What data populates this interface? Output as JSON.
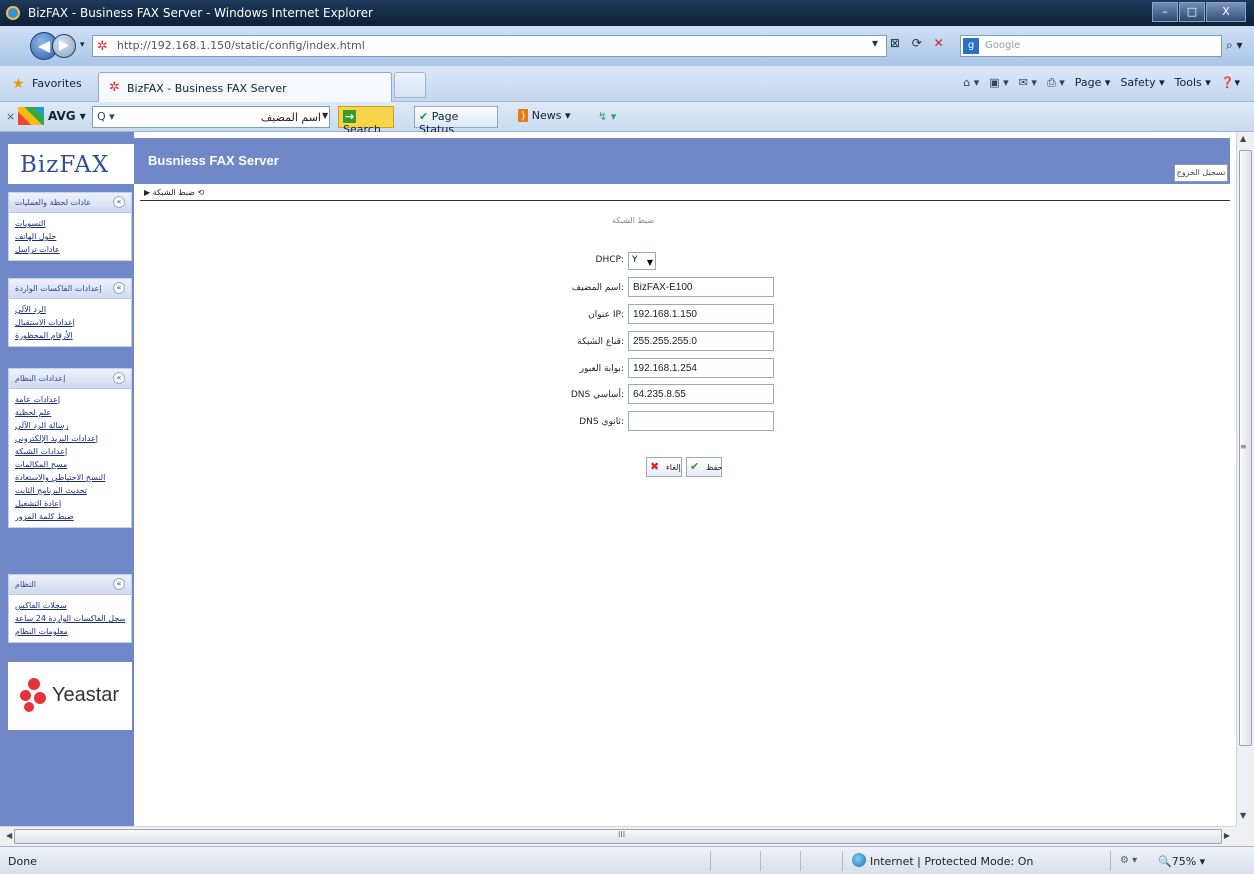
{
  "window": {
    "title": "BizFAX - Business FAX Server - Windows Internet Explorer",
    "minimize": "–",
    "maximize": "□",
    "close": "X"
  },
  "address_bar": {
    "back": "◀",
    "forward": "▶",
    "url": "http://192.168.1.150/static/config/index.html",
    "refresh_icon": "⟳",
    "stop_icon": "✕",
    "search_provider": "Google",
    "search_glyph": "g",
    "search_go": "⌕ ▾"
  },
  "tabs": {
    "favorites": "Favorites",
    "active_tab": "BizFAX - Business FAX Server",
    "commands": {
      "home": "⌂ ▾",
      "feeds": "▣ ▾",
      "mail": "✉ ▾",
      "print": "⎙ ▾",
      "page": "Page ▾",
      "safety": "Safety ▾",
      "tools": "Tools ▾",
      "help": "❓▾"
    }
  },
  "avg_toolbar": {
    "close": "×",
    "label": "AVG ▾",
    "search_icon": "Q ▾",
    "search_value": "اسم المضيف",
    "search_btn_icon": "→",
    "search_btn": "Search",
    "page_status_icon": "✔",
    "page_status": "Page Status",
    "news_icon": ")",
    "news": "News ▾",
    "more": "↯ ▾"
  },
  "app": {
    "logo": "BizFAX",
    "banner_title": "Busniess FAX Server",
    "logout": "تسجيل الخروج",
    "breadcrumb": "▶ ضبط الشبكة ⟲",
    "menus": [
      {
        "title": "عادات لحظة والعمليات",
        "items": [
          "التسويات",
          "حلول الهاتف",
          "عادات تراسل"
        ]
      },
      {
        "title": "إعدادات الفاكسات الواردة",
        "items": [
          "الرد الآلي",
          "إعدادات الاستقبال",
          "الأرقام المحظورة"
        ]
      },
      {
        "title": "إعدادات النظام",
        "items": [
          "إعدادات عامة",
          "علم لحظية",
          "رسالة الرد الآلي",
          "إعدادات البريد الإلكتروني",
          "إعدادات الشبكة",
          "مسح المكالمات",
          "النسخ الاحتياطي والاستعادة",
          "تحديث البرنامج الثابت",
          "إعادة التشغيل",
          "ضبط كلمة المرور"
        ]
      },
      {
        "title": "النظام",
        "items": [
          "سجلات الفاكس",
          "سجل الفاكسات الواردة 24 ساعة",
          "معلومات النظام"
        ]
      }
    ],
    "yeastar": "Yeastar"
  },
  "form": {
    "title": "ضبط الشبكة",
    "dhcp_label": "DHCP:",
    "dhcp_value": "Y",
    "fields": [
      {
        "label": "اسم المضيف:",
        "value": "BizFAX-E100"
      },
      {
        "label": "عنوان IP:",
        "value": "192.168.1.150"
      },
      {
        "label": "قناع الشبكة:",
        "value": "255.255.255.0"
      },
      {
        "label": "بوابة العبور:",
        "value": "192.168.1.254"
      },
      {
        "label": "DNS أساسي:",
        "value": "64.235.8.55"
      },
      {
        "label": "DNS ثانوي:",
        "value": ""
      }
    ],
    "cancel_icon": "✖",
    "cancel": "إلغاء",
    "save_icon": "✔",
    "save": "حفظ"
  },
  "statusbar": {
    "status": "Done",
    "zone": "Internet | Protected Mode: On",
    "security": "⚙ ▾",
    "zoom": "🔍75% ▾"
  },
  "scroll": {
    "up": "▲",
    "down": "▼",
    "left": "◀",
    "right": "▶",
    "grip_v": "≡",
    "grip_h": "III"
  }
}
